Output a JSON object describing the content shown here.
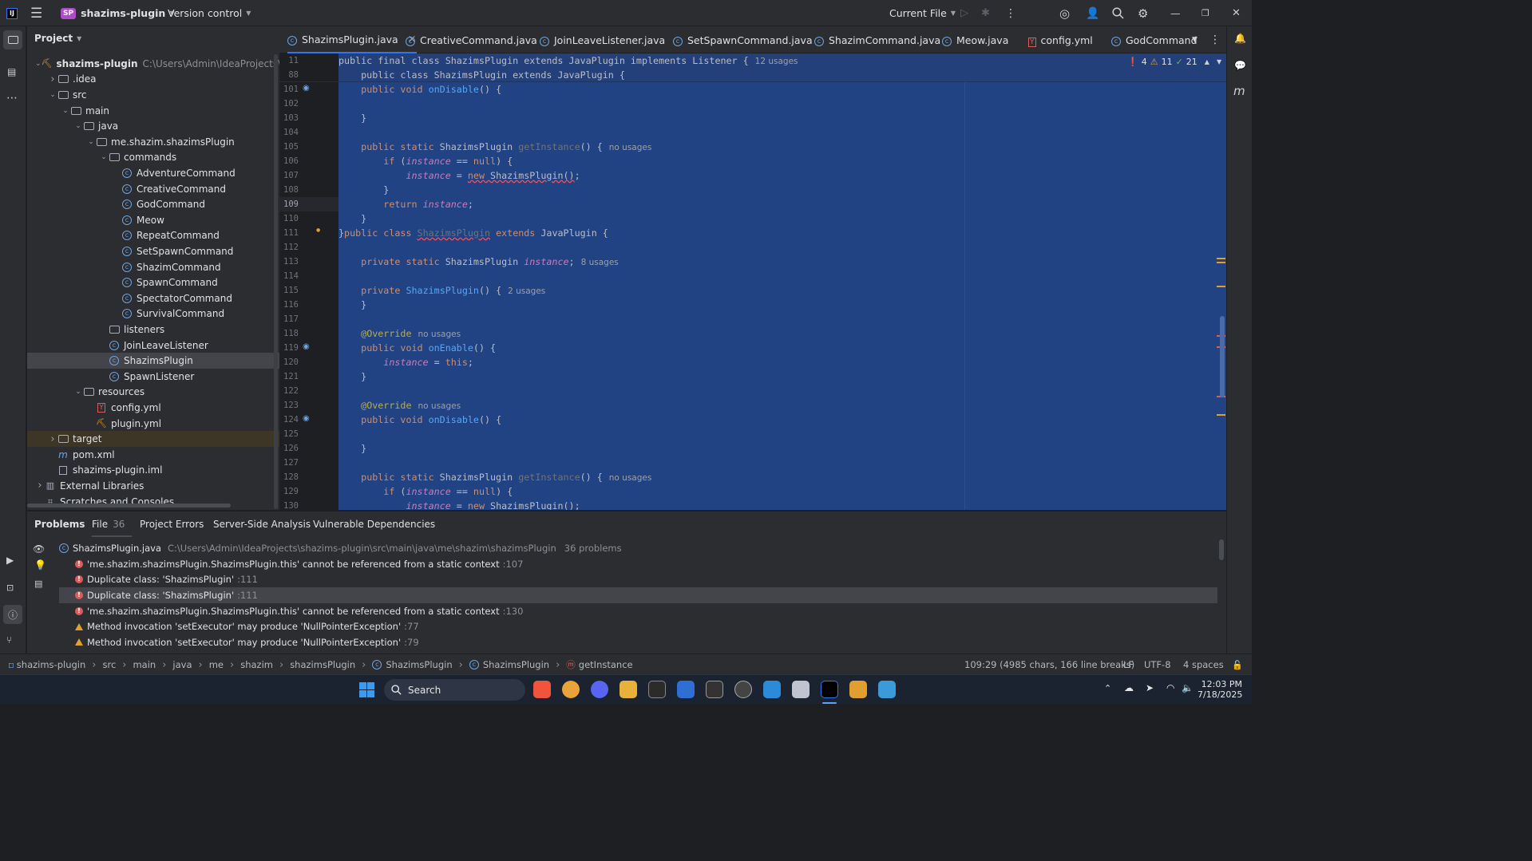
{
  "titlebar": {
    "app_badge": "SP",
    "project_name": "shazims-plugin",
    "vcs_label": "Version control",
    "run_config": "Current File"
  },
  "project_panel": {
    "title": "Project",
    "tree": [
      {
        "label": "shazims-plugin",
        "path": "C:\\Users\\Admin\\IdeaProjects\\shazims",
        "type": "module",
        "indent": 0,
        "expanded": true
      },
      {
        "label": ".idea",
        "type": "folder",
        "indent": 1,
        "expanded": false
      },
      {
        "label": "src",
        "type": "folder",
        "indent": 1,
        "expanded": true
      },
      {
        "label": "main",
        "type": "folder",
        "indent": 2,
        "expanded": true
      },
      {
        "label": "java",
        "type": "folder",
        "indent": 3,
        "expanded": true
      },
      {
        "label": "me.shazim.shazimsPlugin",
        "type": "package",
        "indent": 4,
        "expanded": true
      },
      {
        "label": "commands",
        "type": "package",
        "indent": 5,
        "expanded": true
      },
      {
        "label": "AdventureCommand",
        "type": "class",
        "indent": 6
      },
      {
        "label": "CreativeCommand",
        "type": "class",
        "indent": 6
      },
      {
        "label": "GodCommand",
        "type": "class",
        "indent": 6
      },
      {
        "label": "Meow",
        "type": "class",
        "indent": 6
      },
      {
        "label": "RepeatCommand",
        "type": "class",
        "indent": 6
      },
      {
        "label": "SetSpawnCommand",
        "type": "class",
        "indent": 6
      },
      {
        "label": "ShazimCommand",
        "type": "class",
        "indent": 6
      },
      {
        "label": "SpawnCommand",
        "type": "class",
        "indent": 6
      },
      {
        "label": "SpectatorCommand",
        "type": "class",
        "indent": 6
      },
      {
        "label": "SurvivalCommand",
        "type": "class",
        "indent": 6
      },
      {
        "label": "listeners",
        "type": "package",
        "indent": 5
      },
      {
        "label": "JoinLeaveListener",
        "type": "class",
        "indent": 5
      },
      {
        "label": "ShazimsPlugin",
        "type": "class",
        "indent": 5,
        "selected": true
      },
      {
        "label": "SpawnListener",
        "type": "class",
        "indent": 5
      },
      {
        "label": "resources",
        "type": "folder",
        "indent": 3,
        "expanded": true
      },
      {
        "label": "config.yml",
        "type": "yml",
        "indent": 4
      },
      {
        "label": "plugin.yml",
        "type": "plugin",
        "indent": 4
      },
      {
        "label": "target",
        "type": "folder",
        "indent": 1,
        "expanded": false,
        "excluded": true
      },
      {
        "label": "pom.xml",
        "type": "maven",
        "indent": 1
      },
      {
        "label": "shazims-plugin.iml",
        "type": "iml",
        "indent": 1
      },
      {
        "label": "External Libraries",
        "type": "lib",
        "indent": 0,
        "expanded": false
      },
      {
        "label": "Scratches and Consoles",
        "type": "scratch",
        "indent": 0
      }
    ]
  },
  "editor_tabs": [
    {
      "label": "ShazimsPlugin.java",
      "active": true
    },
    {
      "label": "CreativeCommand.java"
    },
    {
      "label": "JoinLeaveListener.java"
    },
    {
      "label": "SetSpawnCommand.java"
    },
    {
      "label": "ShazimCommand.java"
    },
    {
      "label": "Meow.java"
    },
    {
      "label": "config.yml"
    },
    {
      "label": "GodCommand"
    }
  ],
  "inspections": {
    "errors": "4",
    "warnings": "11",
    "ok": "21"
  },
  "sticky_lines": [
    {
      "num": "11",
      "text": "public final class ShazimsPlugin extends JavaPlugin implements Listener {",
      "usage": "12 usages"
    },
    {
      "num": "88",
      "text": "    public class ShazimsPlugin extends JavaPlugin {",
      "usage": ""
    }
  ],
  "code_lines": [
    {
      "num": "101",
      "html": "    <span class='kw'>public void</span> <span class='fn'>onDisable</span>() {"
    },
    {
      "num": "102",
      "html": ""
    },
    {
      "num": "103",
      "html": "    }"
    },
    {
      "num": "104",
      "html": ""
    },
    {
      "num": "105",
      "html": "    <span class='kw'>public static</span> ShazimsPlugin <span class='gr'>getInstance</span>() {<span class='usage'>no usages</span>"
    },
    {
      "num": "106",
      "html": "        <span class='kw'>if</span> (<span class='it'>instance</span> == <span class='kw'>null</span>) {"
    },
    {
      "num": "107",
      "html": "            <span class='it'>instance</span> = <span class='und'><span class='kw'>new</span> ShazimsPlugin()</span>;"
    },
    {
      "num": "108",
      "html": "        }"
    },
    {
      "num": "109",
      "html": "        <span class='kw'>return</span> <span class='it'>instance</span>;"
    },
    {
      "num": "110",
      "html": "    }"
    },
    {
      "num": "111",
      "html": "}<span class='kw'>public class</span> <span class='gr und'>ShazimsPlugin</span> <span class='kw'>extends</span> JavaPlugin {"
    },
    {
      "num": "112",
      "html": ""
    },
    {
      "num": "113",
      "html": "    <span class='kw'>private static</span> ShazimsPlugin <span class='it'>instance</span>;<span class='usage'>8 usages</span>"
    },
    {
      "num": "114",
      "html": ""
    },
    {
      "num": "115",
      "html": "    <span class='kw'>private</span> <span class='fn'>ShazimsPlugin</span>() {<span class='usage'>2 usages</span>"
    },
    {
      "num": "116",
      "html": "    }"
    },
    {
      "num": "117",
      "html": ""
    },
    {
      "num": "118",
      "html": "    <span class='an'>@Override</span><span class='usage'>no usages</span>"
    },
    {
      "num": "119",
      "html": "    <span class='kw'>public void</span> <span class='fn'>onEnable</span>() {"
    },
    {
      "num": "120",
      "html": "        <span class='it'>instance</span> = <span class='kw'>this</span>;"
    },
    {
      "num": "121",
      "html": "    }"
    },
    {
      "num": "122",
      "html": ""
    },
    {
      "num": "123",
      "html": "    <span class='an'>@Override</span><span class='usage'>no usages</span>"
    },
    {
      "num": "124",
      "html": "    <span class='kw'>public void</span> <span class='fn'>onDisable</span>() {"
    },
    {
      "num": "125",
      "html": ""
    },
    {
      "num": "126",
      "html": "    }"
    },
    {
      "num": "127",
      "html": ""
    },
    {
      "num": "128",
      "html": "    <span class='kw'>public static</span> ShazimsPlugin <span class='gr'>getInstance</span>() {<span class='usage'>no usages</span>"
    },
    {
      "num": "129",
      "html": "        <span class='kw'>if</span> (<span class='it'>instance</span> == <span class='kw'>null</span>) {"
    },
    {
      "num": "130",
      "html": "            <span class='it'>instance</span> = <span class='kw'>new</span> ShazimsPlugin();"
    }
  ],
  "current_line": "109",
  "problems": {
    "tabs": [
      {
        "label": "Problems",
        "active": true
      },
      {
        "label": "File",
        "count": "36"
      },
      {
        "label": "Project Errors"
      },
      {
        "label": "Server-Side Analysis"
      },
      {
        "label": "Vulnerable Dependencies"
      }
    ],
    "file_name": "ShazimsPlugin.java",
    "file_path": "C:\\Users\\Admin\\IdeaProjects\\shazims-plugin\\src\\main\\java\\me\\shazim\\shazimsPlugin",
    "file_count": "36 problems",
    "items": [
      {
        "severity": "error",
        "text": "'me.shazim.shazimsPlugin.ShazimsPlugin.this' cannot be referenced from a static context",
        "line": ":107"
      },
      {
        "severity": "error",
        "text": "Duplicate class: 'ShazimsPlugin'",
        "line": ":111"
      },
      {
        "severity": "error",
        "text": "Duplicate class: 'ShazimsPlugin'",
        "line": ":111",
        "selected": true
      },
      {
        "severity": "error",
        "text": "'me.shazim.shazimsPlugin.ShazimsPlugin.this' cannot be referenced from a static context",
        "line": ":130"
      },
      {
        "severity": "warning",
        "text": "Method invocation 'setExecutor' may produce 'NullPointerException'",
        "line": ":77"
      },
      {
        "severity": "warning",
        "text": "Method invocation 'setExecutor' may produce 'NullPointerException'",
        "line": ":79"
      }
    ]
  },
  "statusbar": {
    "breadcrumbs": [
      "shazims-plugin",
      "src",
      "main",
      "java",
      "me",
      "shazim",
      "shazimsPlugin",
      "ShazimsPlugin",
      "ShazimsPlugin",
      "getInstance"
    ],
    "position": "109:29 (4985 chars, 166 line breaks)",
    "line_sep": "LF",
    "encoding": "UTF-8",
    "indent": "4 spaces"
  },
  "taskbar": {
    "search_label": "Search",
    "time": "12:03 PM",
    "date": "7/18/2025"
  },
  "colors": {
    "accent": "#3574f0",
    "selection": "#214283",
    "error": "#db5c5c",
    "warning": "#e0a030"
  }
}
